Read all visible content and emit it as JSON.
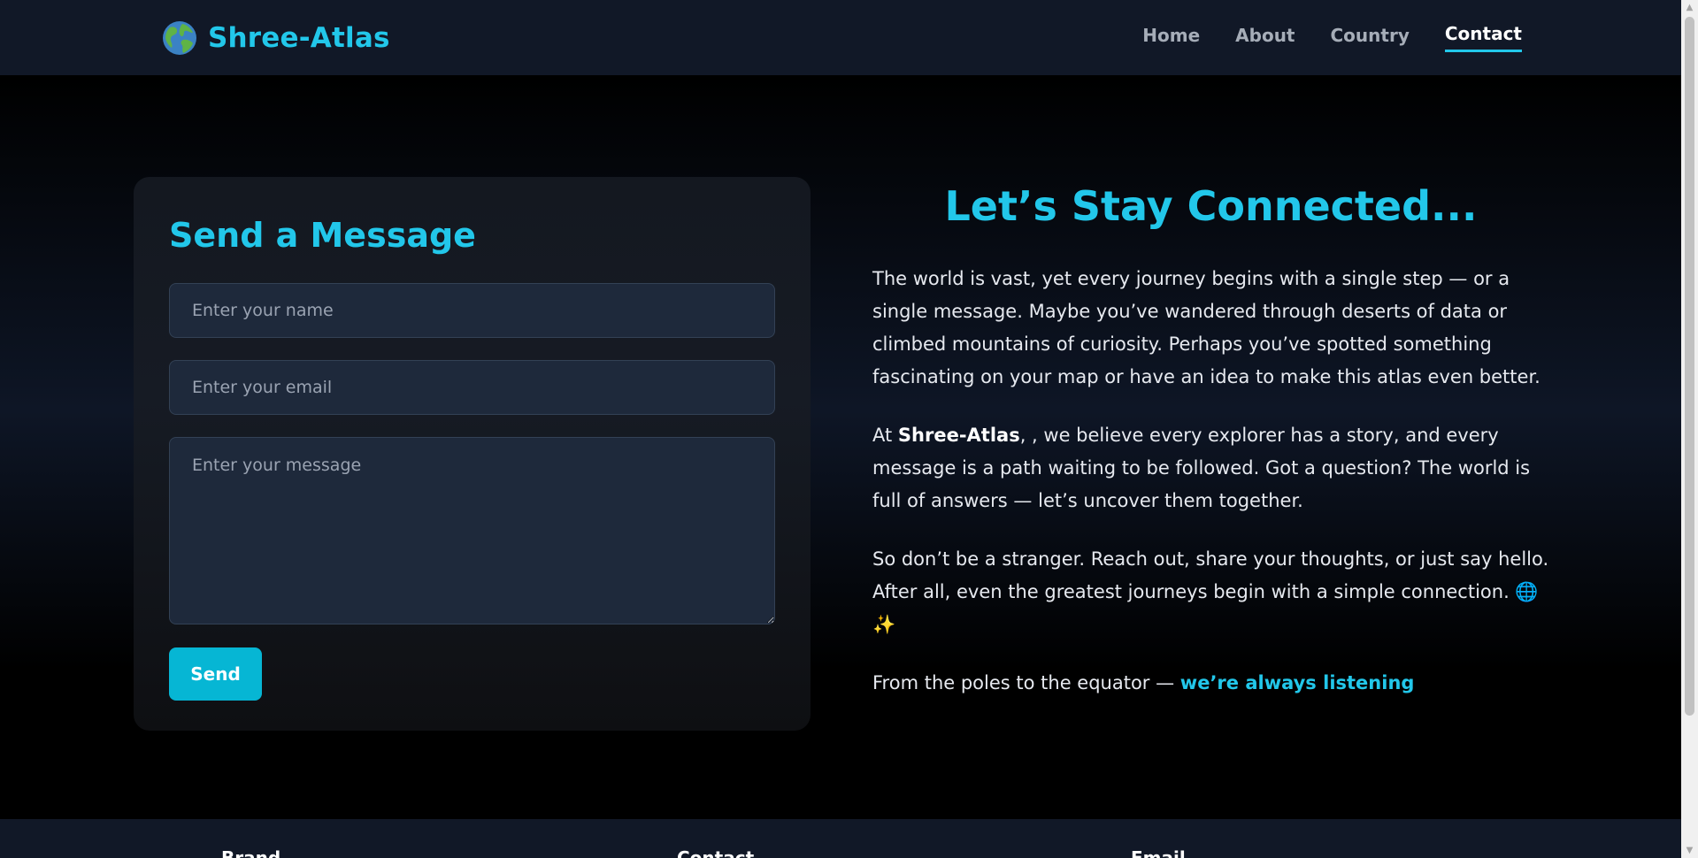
{
  "brand": {
    "name": "Shree-Atlas",
    "logo_icon": "globe-icon"
  },
  "nav": {
    "items": [
      {
        "label": "Home",
        "active": false
      },
      {
        "label": "About",
        "active": false
      },
      {
        "label": "Country",
        "active": false
      },
      {
        "label": "Contact",
        "active": true
      }
    ]
  },
  "form": {
    "title": "Send a Message",
    "name_placeholder": "Enter your name",
    "email_placeholder": "Enter your email",
    "message_placeholder": "Enter your message",
    "name_value": "",
    "email_value": "",
    "message_value": "",
    "send_label": "Send"
  },
  "connect": {
    "title": "Let’s Stay Connected...",
    "p1": "The world is vast, yet every journey begins with a single step — or a single message. Maybe you’ve wandered through deserts of data or climbed mountains of curiosity. Perhaps you’ve spotted something fascinating on your map or have an idea to make this atlas even better.",
    "p2_prefix": "At ",
    "p2_brand": "Shree-Atlas",
    "p2_rest": ", , we believe every explorer has a story, and every message is a path waiting to be followed. Got a question? The world is full of answers — let’s uncover them together.",
    "p3": "So don’t be a stranger. Reach out, share your thoughts, or just say hello. After all, even the greatest journeys begin with a simple connection. 🌐 ✨",
    "p4_prefix": "From the poles to the equator — ",
    "p4_link": "we’re always listening"
  },
  "footer": {
    "col1": "Brand",
    "col2": "Contact",
    "col3": "Email"
  },
  "colors": {
    "accent": "#22c7ea",
    "button": "#06b6d4",
    "navbar_bg": "#111827",
    "field_bg": "#1e293b"
  }
}
